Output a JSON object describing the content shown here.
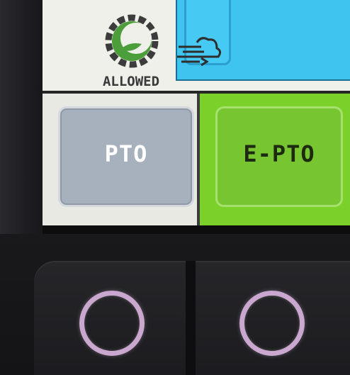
{
  "status": {
    "allowed_label": "ALLOWED"
  },
  "buttons": {
    "pto_label": "PTO",
    "epto_label": "E-PTO"
  },
  "colors": {
    "screen_background": "#f2f2ee",
    "status_blue": "#3fc3ef",
    "pto_gray": "#a7b0bd",
    "epto_green": "#77c631",
    "ring_light": "#c9a7cf"
  },
  "icons": {
    "allowed": "gear-leaf-icon",
    "airflow": "cloud-airflow-icon",
    "soft_key": "ring-led-icon"
  }
}
